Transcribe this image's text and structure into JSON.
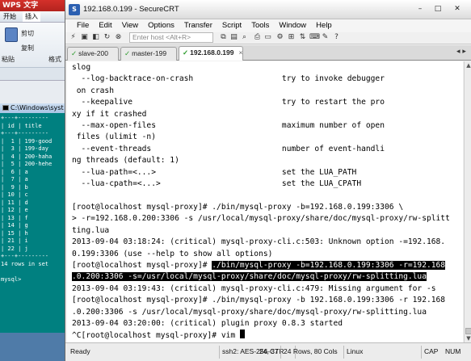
{
  "wps": {
    "title": "WPS 文字",
    "menu": [
      "开始",
      "插入"
    ],
    "ribbon": {
      "cut": "剪切",
      "copy": "复制",
      "paste": "粘贴",
      "format": "格式"
    }
  },
  "cmd": {
    "title": "C:\\Windows\\syst",
    "lines": [
      "+---+---------",
      "| id | title",
      "+---+---------",
      "|  1 | 199-good",
      "|  3 | 199-day",
      "|  4 | 200-haha",
      "|  5 | 200-hehe",
      "|  6 | a",
      "|  7 | a",
      "|  9 | b",
      "| 10 | c",
      "| 11 | d",
      "| 12 | e",
      "| 13 | f",
      "| 14 | g",
      "| 15 | h",
      "| 21 | i",
      "| 22 | j",
      "+---+---------",
      "14 rows in set",
      "",
      "mysql>"
    ]
  },
  "crt": {
    "title": "192.168.0.199 - SecureCRT",
    "app_icon": "S",
    "window_buttons": [
      "–",
      "□",
      "✕"
    ],
    "menu": [
      "File",
      "Edit",
      "View",
      "Options",
      "Transfer",
      "Script",
      "Tools",
      "Window",
      "Help"
    ],
    "host_placeholder": "Enter host <Alt+R>",
    "tabs": [
      {
        "label": "slave-200",
        "active": false
      },
      {
        "label": "master-199",
        "active": false
      },
      {
        "label": "192.168.0.199",
        "active": true
      }
    ],
    "tab_check": "✓",
    "tab_close": "×",
    "tab_nav": "◂ ▸",
    "terminal": [
      {
        "text": "slog",
        "hl": false
      },
      {
        "text": "  --log-backtrace-on-crash                   try to invoke debugger",
        "hl": false
      },
      {
        "text": " on crash",
        "hl": false
      },
      {
        "text": "  --keepalive                                try to restart the pro",
        "hl": false
      },
      {
        "text": "xy if it crashed",
        "hl": false
      },
      {
        "text": "  --max-open-files                           maximum number of open",
        "hl": false
      },
      {
        "text": " files (ulimit -n)",
        "hl": false
      },
      {
        "text": "  --event-threads                            number of event-handli",
        "hl": false
      },
      {
        "text": "ng threads (default: 1)",
        "hl": false
      },
      {
        "text": "  --lua-path=<...>                           set the LUA_PATH",
        "hl": false
      },
      {
        "text": "  --lua-cpath=<...>                          set the LUA_CPATH",
        "hl": false
      },
      {
        "text": "",
        "hl": false
      },
      {
        "text": "[root@localhost mysql-proxy]# ./bin/mysql-proxy -b=192.168.0.199:3306 \\",
        "hl": false
      },
      {
        "text": "> -r=192.168.0.200:3306 -s /usr/local/mysql-proxy/share/doc/mysql-proxy/rw-splitt",
        "hl": false
      },
      {
        "text": "ting.lua",
        "hl": false
      },
      {
        "text": "2013-09-04 03:18:24: (critical) mysql-proxy-cli.c:503: Unknown option -=192.168.",
        "hl": false
      },
      {
        "text": "0.199:3306 (use --help to show all options)",
        "hl": false
      },
      {
        "text": "[root@localhost mysql-proxy]# ",
        "hl": false,
        "hl_tail": "./bin/mysql-proxy -b=192.168.0.199:3306 -r=192.168"
      },
      {
        "text": ".0.200:3306 -s=/usr/local/mysql-proxy/share/doc/mysql-proxy/rw-splitting.lua",
        "hl": true
      },
      {
        "text": "2013-09-04 03:19:43: (critical) mysql-proxy-cli.c:479: Missing argument for -s",
        "hl": false
      },
      {
        "text": "[root@localhost mysql-proxy]# ./bin/mysql-proxy -b 192.168.0.199:3306 -r 192.168",
        "hl": false
      },
      {
        "text": ".0.200:3306 -s /usr/local/mysql-proxy/share/doc/mysql-proxy/rw-splitting.lua",
        "hl": false
      },
      {
        "text": "2013-09-04 03:20:00: (critical) plugin proxy 0.8.3 started",
        "hl": false
      },
      {
        "text": "^C[root@localhost mysql-proxy]# vim ",
        "hl": false,
        "cursor": true
      }
    ],
    "status": {
      "ready": "Ready",
      "cipher": "ssh2: AES-256-CTR",
      "pos": "24,  37",
      "size": "24 Rows, 80 Cols",
      "os": "Linux",
      "cap": "CAP",
      "num": "NUM"
    }
  }
}
